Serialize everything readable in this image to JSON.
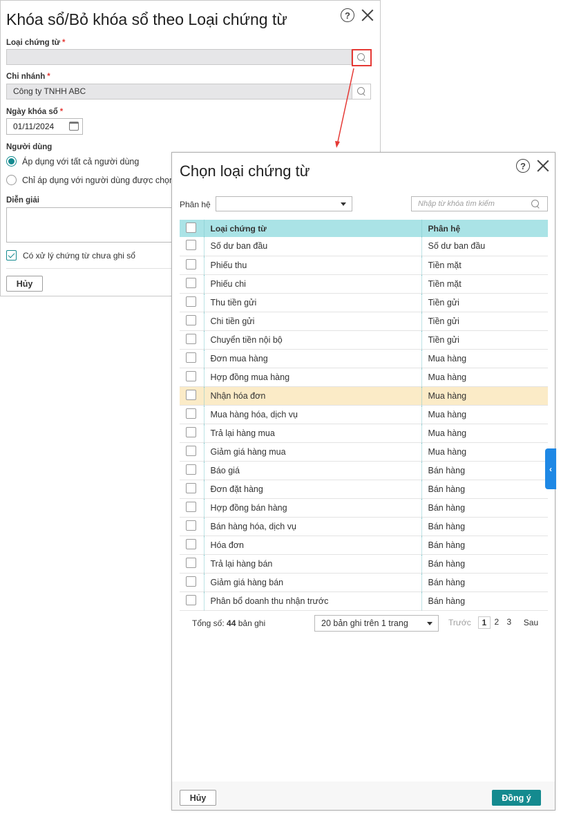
{
  "background_dialog": {
    "title": "Khóa sổ/Bỏ khóa sổ theo Loại chứng từ",
    "voucher_type_label": "Loại chứng từ",
    "branch_label": "Chi nhánh",
    "branch_value": "Công ty TNHH ABC",
    "lock_date_label": "Ngày khóa sổ",
    "lock_date_value": "01/11/2024",
    "users_label": "Người dùng",
    "radio_all": "Áp dụng với tất cả người dùng",
    "radio_selected": "Chỉ áp dụng với người dùng được chọn",
    "description_label": "Diễn giải",
    "unposted_checkbox": "Có xử lý chứng từ chưa ghi sổ",
    "cancel": "Hủy",
    "required_mark": "*"
  },
  "picker_dialog": {
    "title": "Chọn loại chứng từ",
    "module_filter_label": "Phân hệ",
    "search_placeholder": "Nhập từ khóa tìm kiếm",
    "columns": {
      "name": "Loại chứng từ",
      "module": "Phân hệ"
    },
    "rows": [
      {
        "name": "Số dư ban đầu",
        "module": "Số dư ban đầu"
      },
      {
        "name": "Phiếu thu",
        "module": "Tiền mặt"
      },
      {
        "name": "Phiếu chi",
        "module": "Tiền mặt"
      },
      {
        "name": "Thu tiền gửi",
        "module": "Tiền gửi"
      },
      {
        "name": "Chi tiền gửi",
        "module": "Tiền gửi"
      },
      {
        "name": "Chuyển tiền nội bộ",
        "module": "Tiền gửi"
      },
      {
        "name": "Đơn mua hàng",
        "module": "Mua hàng"
      },
      {
        "name": "Hợp đồng mua hàng",
        "module": "Mua hàng"
      },
      {
        "name": "Nhận hóa đơn",
        "module": "Mua hàng"
      },
      {
        "name": "Mua hàng hóa, dịch vụ",
        "module": "Mua hàng"
      },
      {
        "name": "Trả lại hàng mua",
        "module": "Mua hàng"
      },
      {
        "name": "Giảm giá hàng mua",
        "module": "Mua hàng"
      },
      {
        "name": "Báo giá",
        "module": "Bán hàng"
      },
      {
        "name": "Đơn đặt hàng",
        "module": "Bán hàng"
      },
      {
        "name": "Hợp đồng bán hàng",
        "module": "Bán hàng"
      },
      {
        "name": "Bán hàng hóa, dịch vụ",
        "module": "Bán hàng"
      },
      {
        "name": "Hóa đơn",
        "module": "Bán hàng"
      },
      {
        "name": "Trả lại hàng bán",
        "module": "Bán hàng"
      },
      {
        "name": "Giảm giá hàng bán",
        "module": "Bán hàng"
      },
      {
        "name": "Phân bổ doanh thu nhận trước",
        "module": "Bán hàng"
      }
    ],
    "highlighted_row_index": 8,
    "total_prefix": "Tổng số:",
    "total_count": "44",
    "total_suffix": "bản ghi",
    "page_size": "20 bản ghi trên 1 trang",
    "pager": {
      "prev": "Trước",
      "pages": [
        "1",
        "2",
        "3"
      ],
      "current": "1",
      "next": "Sau"
    },
    "cancel": "Hủy",
    "confirm": "Đồng ý"
  },
  "side_tab_glyph": "‹",
  "help_glyph": "?",
  "colors": {
    "accent": "#148a8f",
    "header_bg": "#aae3e6",
    "row_highlight": "#fbebc7",
    "required": "#e53935",
    "side_tab": "#1e88e5"
  }
}
